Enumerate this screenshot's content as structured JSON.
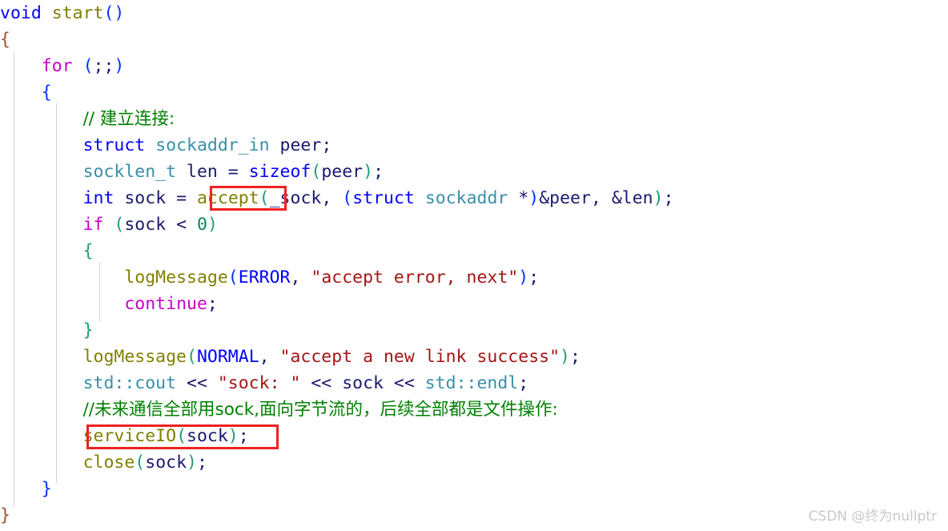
{
  "editor": {
    "language": "cpp",
    "background_color": "#ffffff",
    "indent_guide_color": "#d3d3d3",
    "annotation_color": "#ee2222"
  },
  "code": {
    "line_01": {
      "t1": "void",
      "t2": " ",
      "t3": "start",
      "t4": "()"
    },
    "line_02": {
      "t1": "{"
    },
    "line_03": {
      "indent": "    ",
      "t1": "for",
      "t2": " ",
      "t3": "(",
      "t4": ";;",
      "t5": ")"
    },
    "line_04": {
      "indent": "    ",
      "t1": "{"
    },
    "line_05": {
      "indent": "        ",
      "t1": "// 建立连接:"
    },
    "line_06": {
      "indent": "        ",
      "t1": "struct",
      "t2": " ",
      "t3": "sockaddr_in",
      "t4": " ",
      "t5": "peer",
      "t6": ";"
    },
    "line_07": {
      "indent": "        ",
      "t1": "socklen_t",
      "t2": " ",
      "t3": "len",
      "t4": " = ",
      "t5": "sizeof",
      "t6": "(",
      "t7": "peer",
      "t8": ")",
      "t9": ";"
    },
    "line_08": {
      "indent": "        ",
      "t1": "int",
      "t2": " ",
      "t3": "sock",
      "t4": " = ",
      "t5": "accept",
      "t6": "(",
      "t7": "_sock",
      "t8": ", ",
      "t9": "(",
      "t10": "struct",
      "t11": " ",
      "t12": "sockaddr",
      "t13": " *",
      "t14": ")",
      "t15": "&peer",
      "t16": ", ",
      "t17": "&len",
      "t18": ")",
      "t19": ";"
    },
    "line_09": {
      "indent": "        ",
      "t1": "if",
      "t2": " ",
      "t3": "(",
      "t4": "sock",
      "t5": " < ",
      "t6": "0",
      "t7": ")"
    },
    "line_10": {
      "indent": "        ",
      "t1": "{"
    },
    "line_11": {
      "indent": "            ",
      "t1": "logMessage",
      "t2": "(",
      "t3": "ERROR",
      "t4": ", ",
      "t5": "\"accept error, next\"",
      "t6": ")",
      "t7": ";"
    },
    "line_12": {
      "indent": "            ",
      "t1": "continue",
      "t2": ";"
    },
    "line_13": {
      "indent": "        ",
      "t1": "}"
    },
    "line_14": {
      "indent": "        ",
      "t1": "logMessage",
      "t2": "(",
      "t3": "NORMAL",
      "t4": ", ",
      "t5": "\"accept a new link success\"",
      "t6": ")",
      "t7": ";"
    },
    "line_15": {
      "indent": "        ",
      "t1": "std::cout",
      "t2": " << ",
      "t3": "\"sock: \"",
      "t4": " << ",
      "t5": "sock",
      "t6": " << ",
      "t7": "std::endl",
      "t8": ";"
    },
    "line_16": {
      "indent": "        ",
      "t1": "//未来通信全部用sock,面向字节流的，后续全部都是文件操作:"
    },
    "line_17": {
      "indent": "        ",
      "t1": "serviceIO",
      "t2": "(",
      "t3": "sock",
      "t4": ")",
      "t5": ";"
    },
    "line_18": {
      "indent": "        ",
      "t1": "close",
      "t2": "(",
      "t3": "sock",
      "t4": ")",
      "t5": ";"
    },
    "line_19": {
      "indent": "    ",
      "t1": "}"
    },
    "line_20": {
      "t1": "}"
    }
  },
  "annotations": [
    {
      "name": "accept-highlight",
      "label": "accept"
    },
    {
      "name": "serviceio-highlight",
      "label": "serviceIO(sock);"
    }
  ],
  "watermark": {
    "text": "CSDN @终为nullptr"
  }
}
